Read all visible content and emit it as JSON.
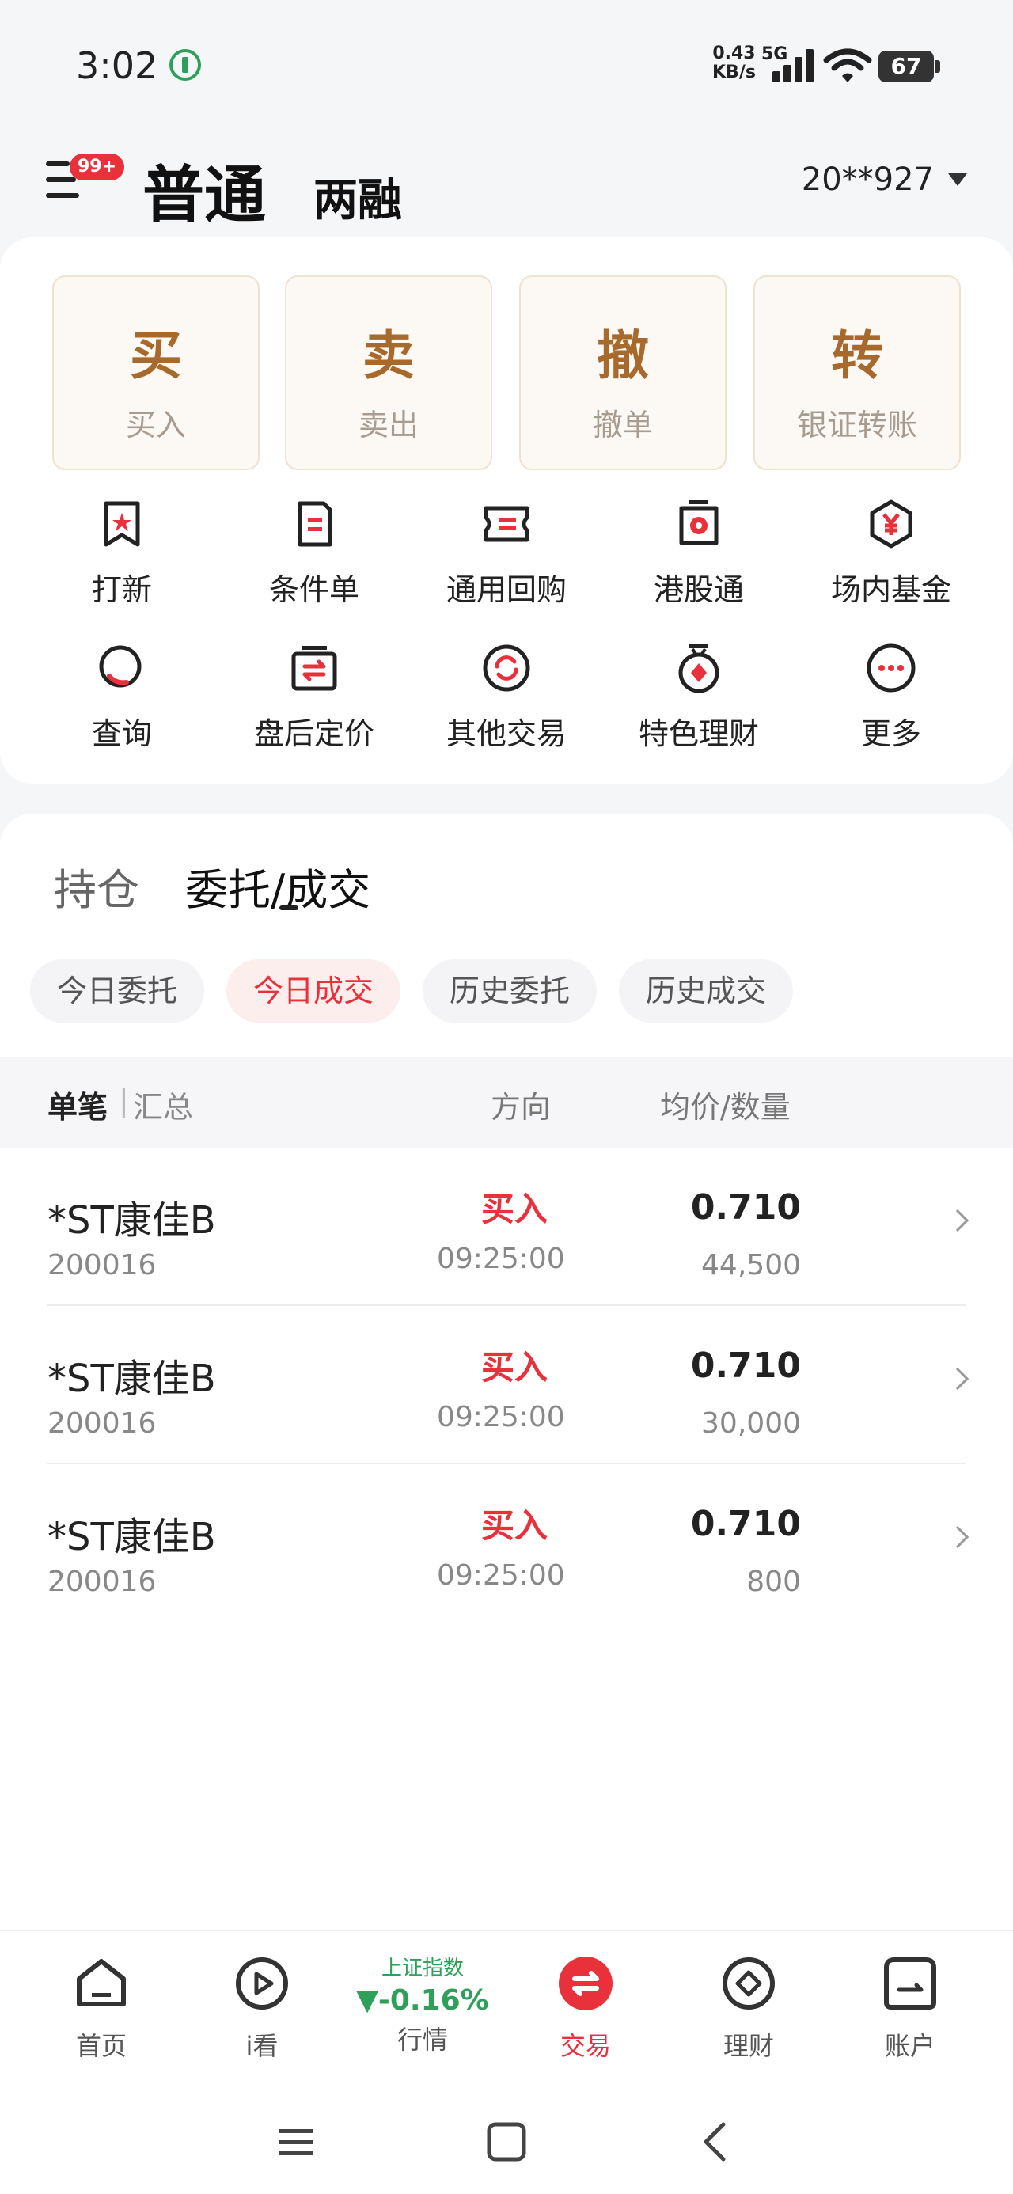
{
  "status_bar": {
    "time": "3:02",
    "net_speed": "0.43",
    "net_unit": "KB/s",
    "network": "5G",
    "battery": "67",
    "signal_icon": "signal-icon",
    "wifi_icon": "wifi-icon"
  },
  "header": {
    "badge": "99+",
    "tab_active": "普通",
    "tab_other": "两融",
    "account": "20**927"
  },
  "trade_buttons": [
    {
      "char": "买",
      "label": "买入"
    },
    {
      "char": "卖",
      "label": "卖出"
    },
    {
      "char": "撤",
      "label": "撤单"
    },
    {
      "char": "转",
      "label": "银证转账"
    }
  ],
  "functions": [
    {
      "label": "打新",
      "icon": "ipo-bookmark-icon"
    },
    {
      "label": "条件单",
      "icon": "condition-order-icon"
    },
    {
      "label": "通用回购",
      "icon": "repo-ticket-icon"
    },
    {
      "label": "港股通",
      "icon": "hk-connect-icon"
    },
    {
      "label": "场内基金",
      "icon": "fund-yen-icon"
    },
    {
      "label": "查询",
      "icon": "search-icon"
    },
    {
      "label": "盘后定价",
      "icon": "after-hours-icon"
    },
    {
      "label": "其他交易",
      "icon": "other-trade-icon"
    },
    {
      "label": "特色理财",
      "icon": "wealth-icon"
    },
    {
      "label": "更多",
      "icon": "more-icon"
    }
  ],
  "orders": {
    "tab_holdings": "持仓",
    "tab_orders": "委托/成交",
    "chips": [
      "今日委托",
      "今日成交",
      "历史委托",
      "历史成交"
    ],
    "active_chip": "今日成交",
    "head_single": "单笔",
    "head_sep": "|",
    "head_summary": "汇总",
    "head_direction": "方向",
    "head_avg": "均价/数量",
    "rows": [
      {
        "name": "*ST康佳B",
        "code": "200016",
        "direction": "买入",
        "time": "09:25:00",
        "price": "0.710",
        "qty": "44,500"
      },
      {
        "name": "*ST康佳B",
        "code": "200016",
        "direction": "买入",
        "time": "09:25:00",
        "price": "0.710",
        "qty": "30,000"
      },
      {
        "name": "*ST康佳B",
        "code": "200016",
        "direction": "买入",
        "time": "09:25:00",
        "price": "0.710",
        "qty": "800"
      }
    ]
  },
  "bottom_nav": {
    "items": [
      {
        "label": "首页",
        "icon": "home-icon"
      },
      {
        "label": "i看",
        "icon": "play-icon"
      },
      {
        "label": "行情",
        "icon": "market-index"
      },
      {
        "label": "交易",
        "icon": "trade-icon"
      },
      {
        "label": "理财",
        "icon": "finance-icon"
      },
      {
        "label": "账户",
        "icon": "account-icon"
      }
    ],
    "index_name": "上证指数",
    "index_value": "▼-0.16%",
    "active": "交易"
  },
  "colors": {
    "accent_red": "#e8313b",
    "brown": "#a86a2c",
    "green": "#2fa05a"
  }
}
